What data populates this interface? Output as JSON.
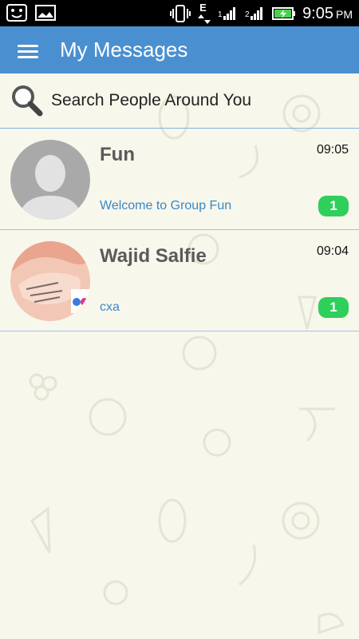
{
  "status_bar": {
    "network_type": "E",
    "time": "9:05",
    "ampm": "PM",
    "icons": [
      "face-icon",
      "image-icon",
      "vibrate-icon",
      "network-arrows-icon",
      "signal-icon",
      "signal-icon-2",
      "battery-charging-icon"
    ]
  },
  "app_bar": {
    "title": "My Messages",
    "menu_icon": "hamburger-menu-icon",
    "color": "#4a8fd0"
  },
  "search": {
    "placeholder": "Search People Around You",
    "icon": "search-icon"
  },
  "conversations": [
    {
      "name": "Fun",
      "time": "09:05",
      "preview": "Welcome to Group Fun",
      "unread": "1",
      "avatar": "default-person-avatar"
    },
    {
      "name": "Wajid Salfie",
      "time": "09:04",
      "preview": "cxa",
      "unread": "1",
      "avatar": "photo-avatar"
    }
  ],
  "colors": {
    "accent": "#4a8fd0",
    "badge": "#2ecf5a",
    "preview_text": "#3a87c8",
    "background": "#f8f7ec"
  }
}
